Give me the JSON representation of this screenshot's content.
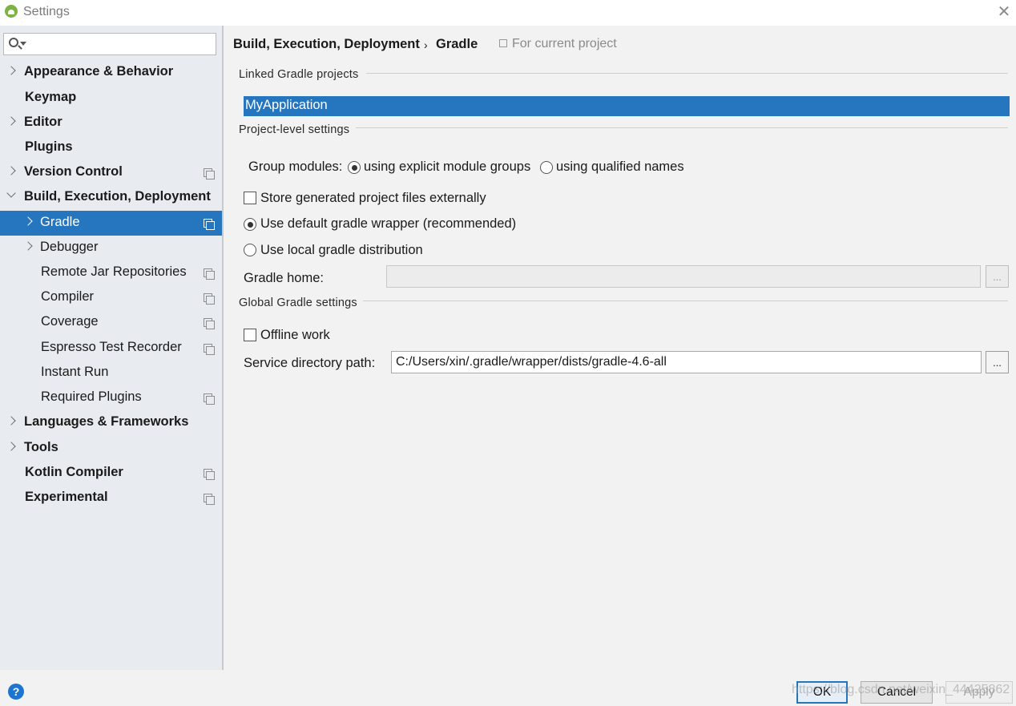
{
  "window": {
    "title": "Settings"
  },
  "sidebar": {
    "search_placeholder": "",
    "items": [
      {
        "label": "Appearance & Behavior",
        "bold": true,
        "expander": "right",
        "project_icon": false
      },
      {
        "label": "Keymap",
        "bold": true,
        "expander": "none",
        "project_icon": false
      },
      {
        "label": "Editor",
        "bold": true,
        "expander": "right",
        "project_icon": false
      },
      {
        "label": "Plugins",
        "bold": true,
        "expander": "none",
        "project_icon": false
      },
      {
        "label": "Version Control",
        "bold": true,
        "expander": "right",
        "project_icon": true
      },
      {
        "label": "Build, Execution, Deployment",
        "bold": true,
        "expander": "down",
        "project_icon": false
      },
      {
        "label": "Gradle",
        "bold": false,
        "expander": "right",
        "project_icon": true,
        "selected": true
      },
      {
        "label": "Debugger",
        "bold": false,
        "expander": "right",
        "project_icon": false
      },
      {
        "label": "Remote Jar Repositories",
        "bold": false,
        "expander": "none",
        "project_icon": true
      },
      {
        "label": "Compiler",
        "bold": false,
        "expander": "none",
        "project_icon": true
      },
      {
        "label": "Coverage",
        "bold": false,
        "expander": "none",
        "project_icon": true
      },
      {
        "label": "Espresso Test Recorder",
        "bold": false,
        "expander": "none",
        "project_icon": true
      },
      {
        "label": "Instant Run",
        "bold": false,
        "expander": "none",
        "project_icon": false
      },
      {
        "label": "Required Plugins",
        "bold": false,
        "expander": "none",
        "project_icon": true
      },
      {
        "label": "Languages & Frameworks",
        "bold": true,
        "expander": "right",
        "project_icon": false
      },
      {
        "label": "Tools",
        "bold": true,
        "expander": "right",
        "project_icon": false
      },
      {
        "label": "Kotlin Compiler",
        "bold": true,
        "expander": "none",
        "project_icon": true
      },
      {
        "label": "Experimental",
        "bold": true,
        "expander": "none",
        "project_icon": true
      }
    ]
  },
  "header": {
    "breadcrumb_parent": "Build, Execution, Deployment",
    "breadcrumb_separator": "›",
    "breadcrumb_current": "Gradle",
    "scope_label": "For current project"
  },
  "linked_projects": {
    "title": "Linked Gradle projects",
    "items": [
      "MyApplication"
    ]
  },
  "project_settings": {
    "title": "Project-level settings",
    "group_modules_label": "Group modules:",
    "group_option_explicit": "using explicit module groups",
    "group_option_qualified": "using qualified names",
    "group_selected": "explicit",
    "store_externally_label": "Store generated project files externally",
    "store_externally_checked": false,
    "wrapper_label": "Use default gradle wrapper (recommended)",
    "local_dist_label": "Use local gradle distribution",
    "distribution_selected": "wrapper",
    "gradle_home_label": "Gradle home:",
    "gradle_home_value": "",
    "browse_label": "..."
  },
  "global_settings": {
    "title": "Global Gradle settings",
    "offline_label": "Offline work",
    "offline_checked": false,
    "service_dir_label": "Service directory path:",
    "service_dir_value": "C:/Users/xin/.gradle/wrapper/dists/gradle-4.6-all",
    "browse_label": "..."
  },
  "footer": {
    "help_label": "?",
    "ok_label": "OK",
    "cancel_label": "Cancel",
    "apply_label": "Apply",
    "watermark": "https://blog.csdn.net/weixin_44425862"
  },
  "colors": {
    "selection": "#2675bf",
    "sidebar_bg": "#e8ecf1",
    "panel_bg": "#f2f2f2"
  }
}
